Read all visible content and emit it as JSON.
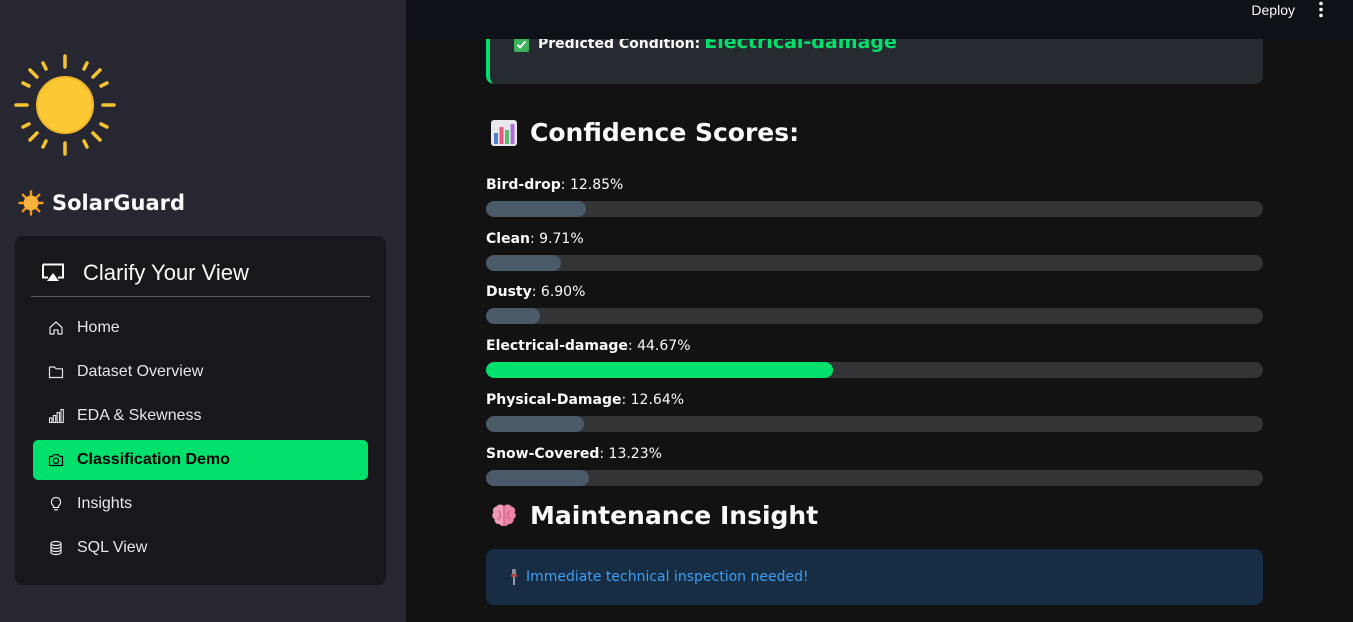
{
  "topbar": {
    "deploy_label": "Deploy"
  },
  "sidebar": {
    "brand": "SolarGuard",
    "nav_title": "Clarify Your View",
    "items": [
      {
        "label": "Home",
        "icon": "home-icon",
        "active": false
      },
      {
        "label": "Dataset Overview",
        "icon": "folder-icon",
        "active": false
      },
      {
        "label": "EDA & Skewness",
        "icon": "bar-chart-icon",
        "active": false
      },
      {
        "label": "Classification Demo",
        "icon": "camera-icon",
        "active": true
      },
      {
        "label": "Insights",
        "icon": "lightbulb-icon",
        "active": false
      },
      {
        "label": "SQL View",
        "icon": "database-icon",
        "active": false
      }
    ]
  },
  "prediction": {
    "label": "Predicted Condition:",
    "value": "Electrical-damage"
  },
  "confidence": {
    "title": "Confidence Scores:",
    "scores": [
      {
        "name": "Bird-drop",
        "text": "12.85%",
        "value": 12.85,
        "highlight": false
      },
      {
        "name": "Clean",
        "text": "9.71%",
        "value": 9.71,
        "highlight": false
      },
      {
        "name": "Dusty",
        "text": "6.90%",
        "value": 6.9,
        "highlight": false
      },
      {
        "name": "Electrical-damage",
        "text": "44.67%",
        "value": 44.67,
        "highlight": true
      },
      {
        "name": "Physical-Damage",
        "text": "12.64%",
        "value": 12.64,
        "highlight": false
      },
      {
        "name": "Snow-Covered",
        "text": "13.23%",
        "value": 13.23,
        "highlight": false
      }
    ]
  },
  "maintenance": {
    "title": "Maintenance Insight",
    "message": "Immediate technical inspection needed!"
  },
  "colors": {
    "accent": "#00e06b",
    "bar_default": "#4a5a69",
    "info_text": "#3d9df3"
  }
}
